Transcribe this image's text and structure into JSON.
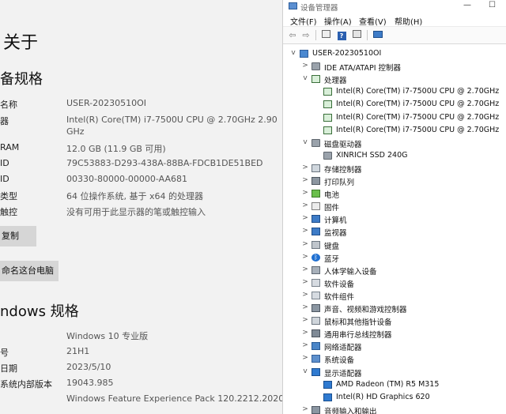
{
  "settings": {
    "page_title": "关于",
    "device_spec_title": "备规格",
    "device_specs": [
      {
        "label": "名称",
        "value": "USER-20230510OI"
      },
      {
        "label": "器",
        "value": "Intel(R) Core(TM) i7-7500U CPU @ 2.70GHz   2.90",
        "value2": "GHz"
      },
      {
        "label": "RAM",
        "value": "12.0 GB (11.9 GB 可用)"
      },
      {
        "label": "ID",
        "value": "79C53883-D293-438A-88BA-FDCB1DE51BED"
      },
      {
        "label": "ID",
        "value": "00330-80000-00000-AA681"
      },
      {
        "label": "类型",
        "value": "64 位操作系统, 基于 x64 的处理器"
      },
      {
        "label": "触控",
        "value": "没有可用于此显示器的笔或触控输入"
      }
    ],
    "copy_button": "复制",
    "rename_button": "命名这台电脑",
    "windows_spec_title": "ndows 规格",
    "windows_specs": [
      {
        "label": "",
        "value": "Windows 10 专业版"
      },
      {
        "label": "号",
        "value": "21H1"
      },
      {
        "label": "日期",
        "value": "2023/5/10"
      },
      {
        "label": "系统内部版本",
        "value": "19043.985"
      },
      {
        "label": "",
        "value": "Windows Feature Experience Pack 120.2212.2020.0"
      }
    ]
  },
  "device_manager": {
    "title": "设备管理器",
    "window_controls": {
      "minimize": "—",
      "maximize": "☐"
    },
    "menu": [
      "文件(F)",
      "操作(A)",
      "查看(V)",
      "帮助(H)"
    ],
    "toolbar_icons": [
      "back-arrow-icon",
      "forward-arrow-icon",
      "properties-icon",
      "help-icon",
      "view-icon",
      "monitor-icon"
    ],
    "tree": [
      {
        "level": 0,
        "exp": "v",
        "icon": "pc",
        "label": "USER-20230510OI"
      },
      {
        "level": 1,
        "exp": ">",
        "icon": "disk",
        "label": "IDE ATA/ATAPI 控制器"
      },
      {
        "level": 1,
        "exp": "v",
        "icon": "cpu",
        "label": "处理器"
      },
      {
        "level": 2,
        "exp": "",
        "icon": "cpu",
        "label": "Intel(R) Core(TM) i7-7500U CPU @ 2.70GHz"
      },
      {
        "level": 2,
        "exp": "",
        "icon": "cpu",
        "label": "Intel(R) Core(TM) i7-7500U CPU @ 2.70GHz"
      },
      {
        "level": 2,
        "exp": "",
        "icon": "cpu",
        "label": "Intel(R) Core(TM) i7-7500U CPU @ 2.70GHz"
      },
      {
        "level": 2,
        "exp": "",
        "icon": "cpu",
        "label": "Intel(R) Core(TM) i7-7500U CPU @ 2.70GHz"
      },
      {
        "level": 1,
        "exp": "v",
        "icon": "disk",
        "label": "磁盘驱动器"
      },
      {
        "level": 2,
        "exp": "",
        "icon": "disk",
        "label": "XINRICH SSD 240G"
      },
      {
        "level": 1,
        "exp": ">",
        "icon": "ctrl",
        "label": "存储控制器"
      },
      {
        "level": 1,
        "exp": ">",
        "icon": "print",
        "label": "打印队列"
      },
      {
        "level": 1,
        "exp": ">",
        "icon": "battery",
        "label": "电池"
      },
      {
        "level": 1,
        "exp": ">",
        "icon": "firm",
        "label": "固件"
      },
      {
        "level": 1,
        "exp": ">",
        "icon": "monitor",
        "label": "计算机"
      },
      {
        "level": 1,
        "exp": ">",
        "icon": "monitor",
        "label": "监视器"
      },
      {
        "level": 1,
        "exp": ">",
        "icon": "kbd",
        "label": "键盘"
      },
      {
        "level": 1,
        "exp": ">",
        "icon": "bt",
        "label": "蓝牙"
      },
      {
        "level": 1,
        "exp": ">",
        "icon": "hid",
        "label": "人体学输入设备"
      },
      {
        "level": 1,
        "exp": ">",
        "icon": "soft",
        "label": "软件设备"
      },
      {
        "level": 1,
        "exp": ">",
        "icon": "soft",
        "label": "软件组件"
      },
      {
        "level": 1,
        "exp": ">",
        "icon": "audio",
        "label": "声音、视频和游戏控制器"
      },
      {
        "level": 1,
        "exp": ">",
        "icon": "mouse",
        "label": "鼠标和其他指针设备"
      },
      {
        "level": 1,
        "exp": ">",
        "icon": "usb",
        "label": "通用串行总线控制器"
      },
      {
        "level": 1,
        "exp": ">",
        "icon": "net",
        "label": "网络适配器"
      },
      {
        "level": 1,
        "exp": ">",
        "icon": "sys",
        "label": "系统设备"
      },
      {
        "level": 1,
        "exp": "v",
        "icon": "gpu",
        "label": "显示适配器"
      },
      {
        "level": 2,
        "exp": "",
        "icon": "gpu",
        "label": "AMD Radeon (TM) R5 M315"
      },
      {
        "level": 2,
        "exp": "",
        "icon": "gpu",
        "label": "Intel(R) HD Graphics 620"
      },
      {
        "level": 1,
        "exp": ">",
        "icon": "audio",
        "label": "音频输入和输出"
      }
    ]
  }
}
